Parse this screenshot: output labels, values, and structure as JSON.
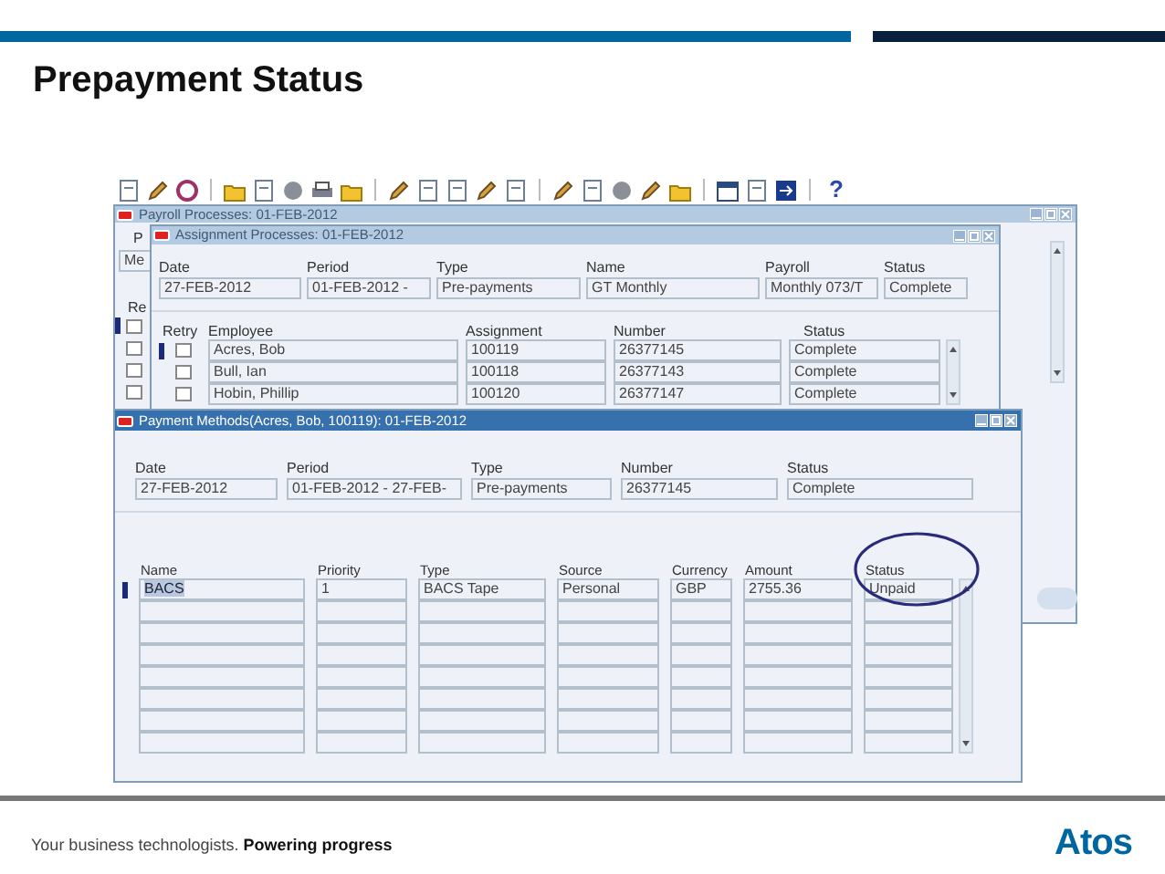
{
  "slide": {
    "title": "Prepayment Status",
    "tagline": "Your business technologists. **Powering progress**",
    "logo": "Atos"
  },
  "toolbar": {
    "help": "?"
  },
  "payroll_window": {
    "title": "Payroll Processes: 01-FEB-2012",
    "fragments": [
      "P",
      "Me",
      "Re"
    ],
    "rows": [
      {
        "checked": false,
        "selected": true
      },
      {
        "checked": false,
        "selected": false
      },
      {
        "checked": false,
        "selected": false
      },
      {
        "checked": false,
        "selected": false
      }
    ]
  },
  "assignment_window": {
    "title": "Assignment Processes: 01-FEB-2012",
    "fields": [
      {
        "label": "Date",
        "value": "27-FEB-2012"
      },
      {
        "label": "Period",
        "value": "01-FEB-2012 -"
      },
      {
        "label": "Type",
        "value": "Pre-payments"
      },
      {
        "label": "Name",
        "value": "GT Monthly"
      },
      {
        "label": "Payroll",
        "value": "Monthly 073/T"
      },
      {
        "label": "Status",
        "value": "Complete"
      }
    ],
    "columns": [
      "Retry",
      "Employee",
      "Assignment",
      "Number",
      "Status"
    ],
    "rows": [
      {
        "retry": false,
        "employee": "Acres, Bob",
        "assignment": "100119",
        "number": "26377145",
        "status": "Complete",
        "selected": true
      },
      {
        "retry": false,
        "employee": "Bull, Ian",
        "assignment": "100118",
        "number": "26377143",
        "status": "Complete",
        "selected": false
      },
      {
        "retry": false,
        "employee": "Hobin, Phillip",
        "assignment": "100120",
        "number": "26377147",
        "status": "Complete",
        "selected": false
      }
    ]
  },
  "payment_window": {
    "title": "Payment Methods(Acres, Bob, 100119): 01-FEB-2012",
    "fields": [
      {
        "label": "Date",
        "value": "27-FEB-2012"
      },
      {
        "label": "Period",
        "value": "01-FEB-2012 - 27-FEB-"
      },
      {
        "label": "Type",
        "value": "Pre-payments"
      },
      {
        "label": "Number",
        "value": "26377145"
      },
      {
        "label": "Status",
        "value": "Complete"
      }
    ],
    "columns": [
      "Name",
      "Priority",
      "Type",
      "Source",
      "Currency",
      "Amount",
      "Status"
    ],
    "rows": [
      {
        "cells": [
          "BACS",
          "1",
          "BACS Tape",
          "Personal",
          "GBP",
          "2755.36",
          "Unpaid"
        ],
        "selected": true
      }
    ]
  }
}
